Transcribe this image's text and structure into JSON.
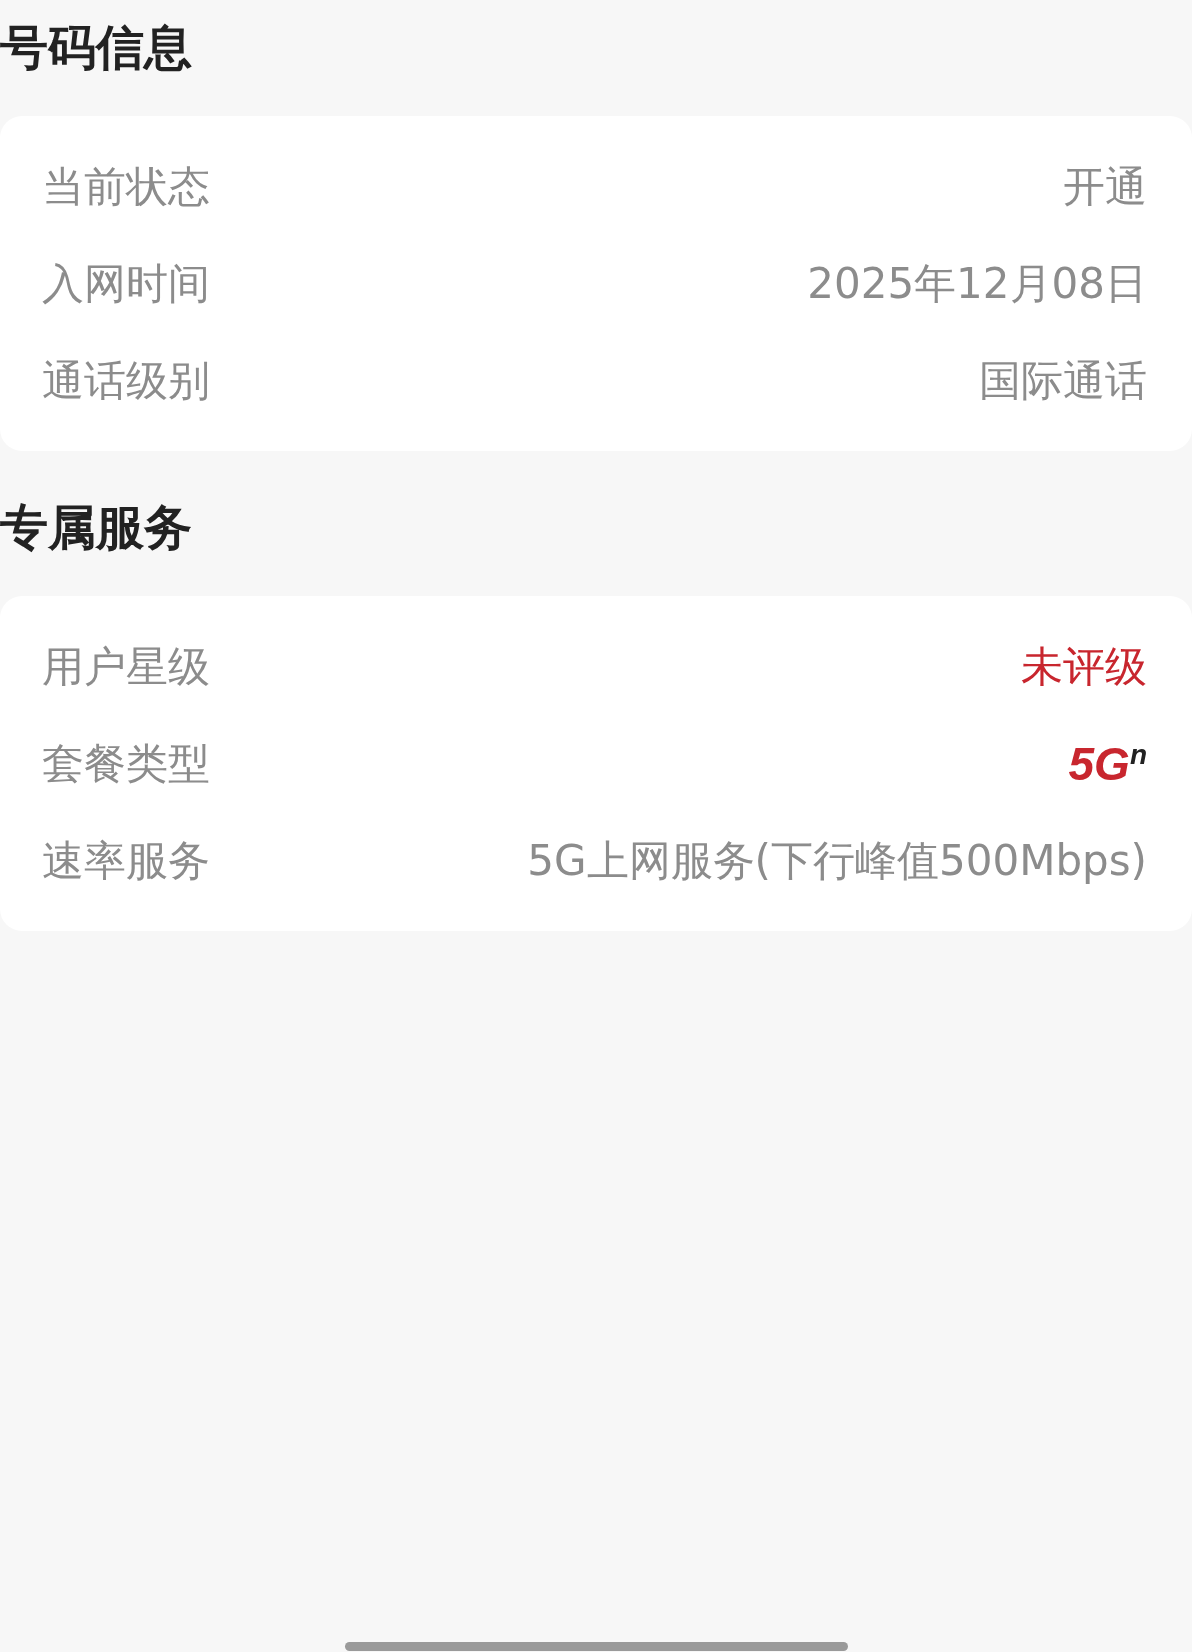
{
  "sections": [
    {
      "title": "号码信息",
      "rows": [
        {
          "label": "当前状态",
          "value": "开通",
          "kind": "text"
        },
        {
          "label": "入网时间",
          "value": "2025年12月08日",
          "kind": "text"
        },
        {
          "label": "通话级别",
          "value": "国际通话",
          "kind": "text"
        }
      ]
    },
    {
      "title": "专属服务",
      "rows": [
        {
          "label": "用户星级",
          "value": "未评级",
          "kind": "highlight"
        },
        {
          "label": "套餐类型",
          "value": "5G$^{n}$",
          "kind": "logo"
        },
        {
          "label": "速率服务",
          "value": "5G上网服务(下行峰值500Mbps)",
          "kind": "text"
        }
      ]
    }
  ]
}
